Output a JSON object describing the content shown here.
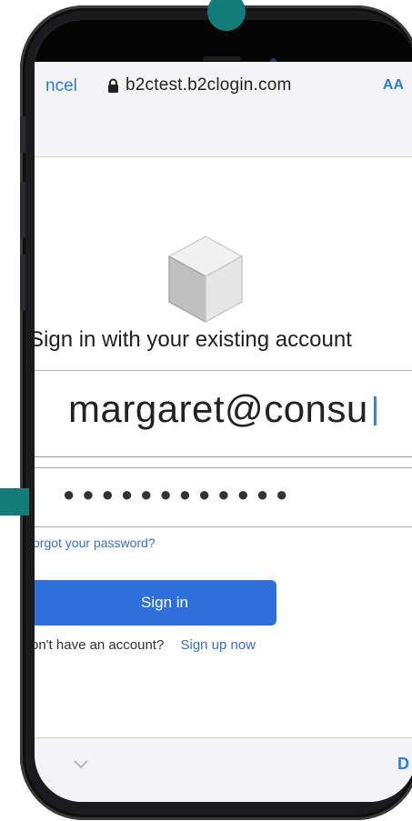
{
  "browser": {
    "cancel_label": "ncel",
    "url": "b2ctest.b2clogin.com",
    "text_size_label": "AA"
  },
  "signin_form": {
    "heading": "Sign in with your existing account",
    "email_value": "margaret@consu",
    "password_mask": "●●●●●●●●●●●●",
    "forgot_password": "orgot your password?",
    "signin_button": "Sign in",
    "no_account_text": "on't have an account?",
    "signup_link": "Sign up now"
  },
  "keyboard_toolbar": {
    "done_label": "D"
  },
  "colors": {
    "accent": "#2f6fdc",
    "link": "#2a7de1",
    "teal_marker": "#137b78"
  }
}
